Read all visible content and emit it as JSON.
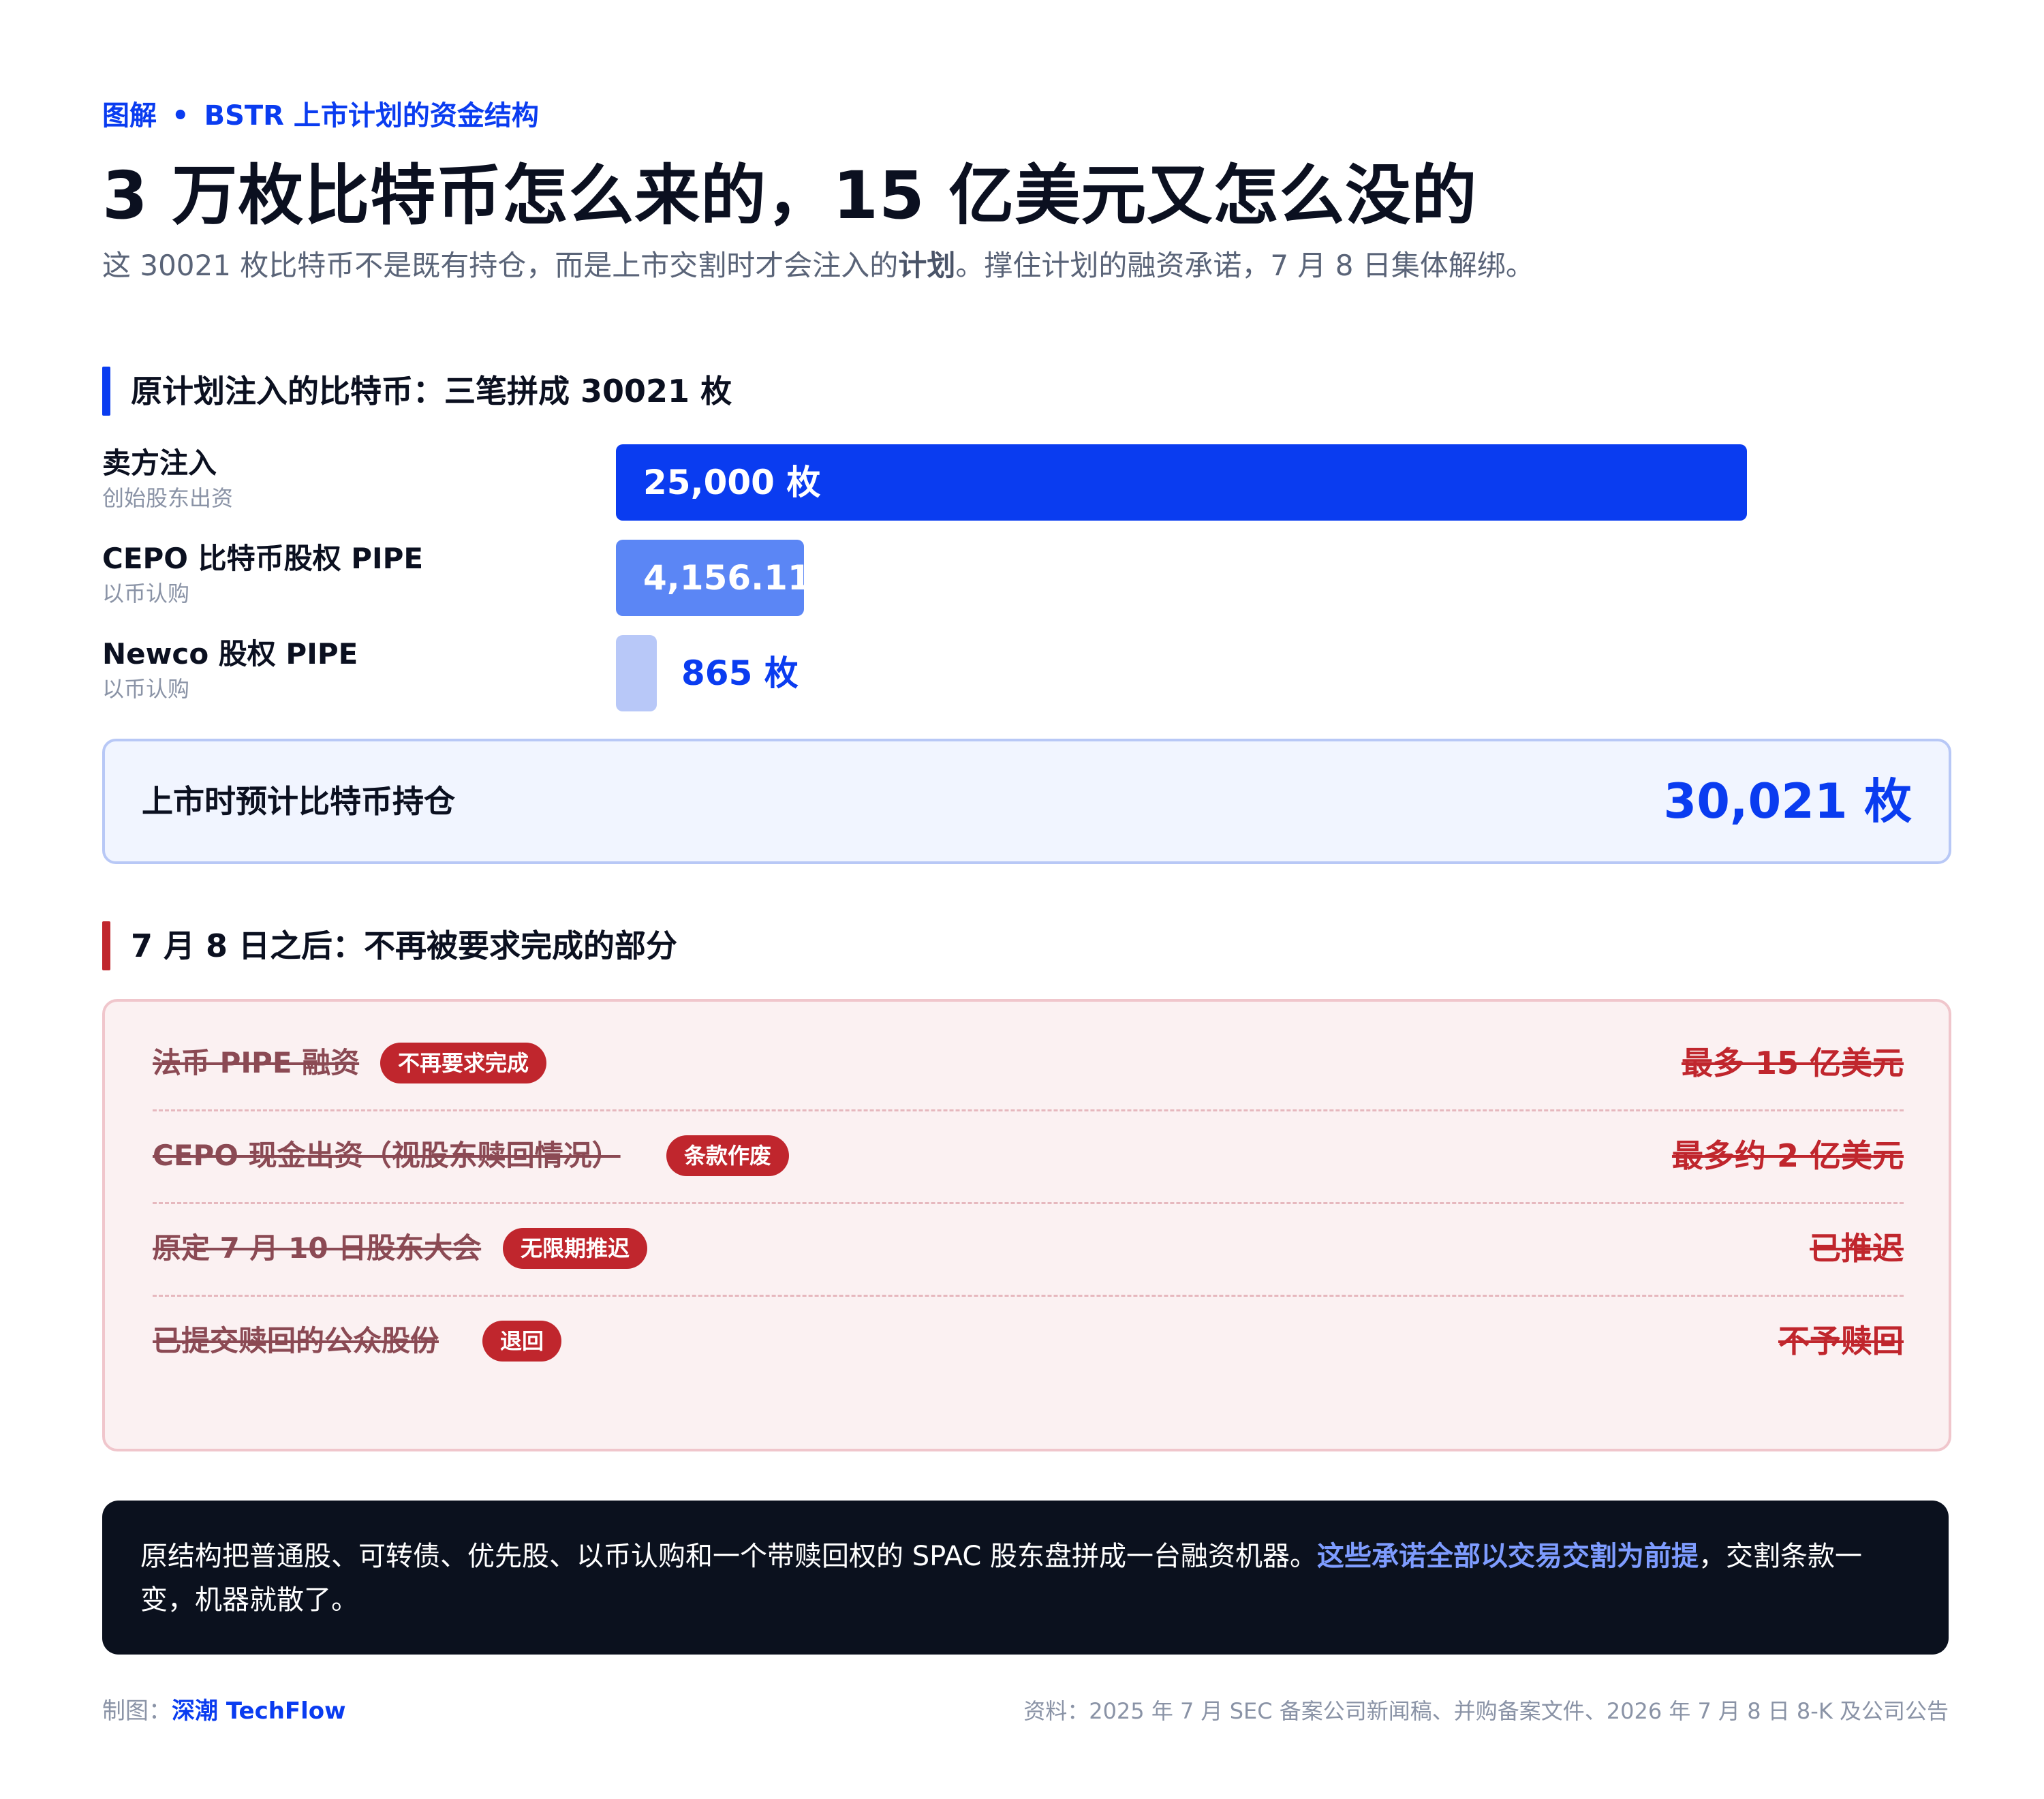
{
  "header": {
    "kicker_prefix": "图解",
    "kicker_sep": "•",
    "kicker_topic": "BSTR 上市计划的资金结构",
    "title": "3 万枚比特币怎么来的，15 亿美元又怎么没的",
    "subtitle_before": "这 30021 枚比特币不是既有持仓，而是上市交割时才会注入的",
    "subtitle_bold": "计划",
    "subtitle_after": "。撑住计划的融资承诺，7 月 8 日集体解绑。"
  },
  "section1": {
    "title": "原计划注入的比特币：三笔拼成 30021 枚"
  },
  "chart_data": {
    "type": "bar",
    "orientation": "horizontal",
    "unit": "枚",
    "categories": [
      "卖方注入",
      "CEPO 比特币股权 PIPE",
      "Newco 股权 PIPE"
    ],
    "subcategories": [
      "创始股东出资",
      "以币认购",
      "以币认购"
    ],
    "values": [
      25000,
      4156.11,
      865
    ],
    "value_labels": [
      "25,000 枚",
      "4,156.11",
      "865 枚"
    ],
    "colors": [
      "#0a3cf0",
      "#5b86f5",
      "#b8c8f8"
    ],
    "total_label": "上市时预计比特币持仓",
    "total_value_label": "30,021 枚",
    "total": 30021
  },
  "section2": {
    "title": "7 月 8 日之后：不再被要求完成的部分",
    "items": [
      {
        "label": "法币 PIPE 融资",
        "badge": "不再要求完成",
        "value": "最多 15 亿美元"
      },
      {
        "label": "CEPO 现金出资（视股东赎回情况）",
        "badge": "条款作废",
        "value": "最多约 2 亿美元"
      },
      {
        "label": "原定 7 月 10 日股东大会",
        "badge": "无限期推迟",
        "value": "已推迟"
      },
      {
        "label": "已提交赎回的公众股份",
        "badge": "退回",
        "value": "不予赎回"
      }
    ]
  },
  "note": {
    "before": "原结构把普通股、可转债、优先股、以币认购和一个带赎回权的 SPAC 股东盘拼成一台融资机器。",
    "highlight": "这些承诺全部以交易交割为前提",
    "after": "，交割条款一变，机器就散了。"
  },
  "footer": {
    "credit_prefix": "制图：",
    "credit_brand": "深潮 TechFlow",
    "source": "资料：2025 年 7 月 SEC 备案公司新闻稿、并购备案文件、2026 年 7 月 8 日 8-K 及公司公告"
  },
  "colors": {
    "accent_blue": "#0a3cf0",
    "accent_red": "#c0262d",
    "dark": "#0b111e"
  }
}
